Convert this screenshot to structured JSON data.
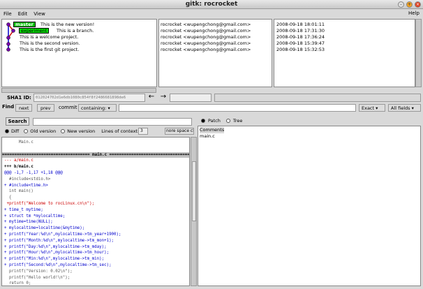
{
  "window": {
    "title": "gitk: rocrocket"
  },
  "menu": {
    "file": "File",
    "edit": "Edit",
    "view": "View",
    "help": "Help"
  },
  "branches": {
    "master": "master",
    "experiment": "experiment"
  },
  "commits": [
    {
      "msg": "This is the new version!",
      "author": "rocrocket <wupengchong@gmail.com>",
      "date": "2008-09-18 18:01:11"
    },
    {
      "msg": "This is a branch.",
      "author": "rocrocket <wupengchong@gmail.com>",
      "date": "2008-09-18 17:31:30"
    },
    {
      "msg": "This is a welcome project.",
      "author": "rocrocket <wupengchong@gmail.com>",
      "date": "2008-09-18 17:36:24"
    },
    {
      "msg": "This is the second version.",
      "author": "rocrocket <wupengchong@gmail.com>",
      "date": "2008-09-18 15:39:47"
    },
    {
      "msg": "This is the first git project.",
      "author": "rocrocket <wupengchong@gmail.com>",
      "date": "2008-09-18 15:32:53"
    }
  ],
  "sha": {
    "label": "SHA1 ID:",
    "value": "012024702d1e6db1080c854f8f2486681898de6"
  },
  "find": {
    "label": "Find",
    "next": "next",
    "prev": "prev",
    "commit": "commit",
    "containing": "containing:",
    "exact": "Exact",
    "all_fields": "All fields"
  },
  "search": {
    "button": "Search",
    "diff": "Diff",
    "old_version": "Old version",
    "new_version": "New version",
    "lines_of_context": "Lines of context:",
    "context_value": "3",
    "ignore_space": "nore space cl"
  },
  "diff": [
    {
      "text": "      Main.c",
      "color": "#555555",
      "type": "normal"
    },
    {
      "text": "",
      "color": "#000000",
      "type": "normal"
    },
    {
      "text": "==================================== main.c ====================================",
      "color": "#000000",
      "type": "head"
    },
    {
      "text": "--- a/main.c",
      "color": "#cc0000",
      "type": "normal"
    },
    {
      "text": "+++ b/main.c",
      "color": "#000000",
      "type": "bold"
    },
    {
      "text": "@@@ -1,7 -1,17 +1,18 @@@",
      "color": "#0000cc",
      "type": "normal"
    },
    {
      "text": "  #include<stdio.h>",
      "color": "#555555",
      "type": "normal"
    },
    {
      "text": "+ #include<time.h>",
      "color": "#0000cc",
      "type": "normal"
    },
    {
      "text": "  int main()",
      "color": "#555555",
      "type": "normal"
    },
    {
      "text": "  {",
      "color": "#555555",
      "type": "normal"
    },
    {
      "text": " +printf(\"Welcome to rocLinux.cn\\n\");",
      "color": "#cc0000",
      "type": "normal"
    },
    {
      "text": "+ time_t mytime;",
      "color": "#0000cc",
      "type": "normal"
    },
    {
      "text": "+ struct tm *mylocaltime;",
      "color": "#0000cc",
      "type": "normal"
    },
    {
      "text": "+ mytime=time(NULL);",
      "color": "#0000cc",
      "type": "normal"
    },
    {
      "text": "+ mylocaltime=localtime(&mytime);",
      "color": "#0000cc",
      "type": "normal"
    },
    {
      "text": "+ printf(\"Year:%d\\n\",mylocaltime->tm_year+1900);",
      "color": "#0000cc",
      "type": "normal"
    },
    {
      "text": "+ printf(\"Month:%d\\n\",mylocaltime->tm_mon+1);",
      "color": "#0000cc",
      "type": "normal"
    },
    {
      "text": "+ printf(\"Day:%d\\n\",mylocaltime->tm_mday);",
      "color": "#0000cc",
      "type": "normal"
    },
    {
      "text": "+ printf(\"Hour:%d\\n\",mylocaltime->tm_hour);",
      "color": "#0000cc",
      "type": "normal"
    },
    {
      "text": "+ printf(\"Min:%d\\n\",mylocaltime->tm_min);",
      "color": "#0000cc",
      "type": "normal"
    },
    {
      "text": "+ printf(\"Second:%d\\n\",mylocaltime->tm_sec);",
      "color": "#0000cc",
      "type": "normal"
    },
    {
      "text": "  printf(\"Version: 0.02\\n\");",
      "color": "#555555",
      "type": "normal"
    },
    {
      "text": "  printf(\"Hello world!\\n\");",
      "color": "#555555",
      "type": "normal"
    },
    {
      "text": "  return 0;",
      "color": "#555555",
      "type": "normal"
    }
  ],
  "files": {
    "patch": "Patch",
    "tree": "Tree",
    "items": [
      "Comments",
      "main.c"
    ]
  },
  "colors": {
    "branch_green": "#00e000",
    "graph_blue": "#0000cc",
    "graph_red": "#cc0000",
    "graph_purple": "#7700aa"
  },
  "icons": {
    "back": "arrow-left-icon",
    "forward": "arrow-right-icon"
  }
}
